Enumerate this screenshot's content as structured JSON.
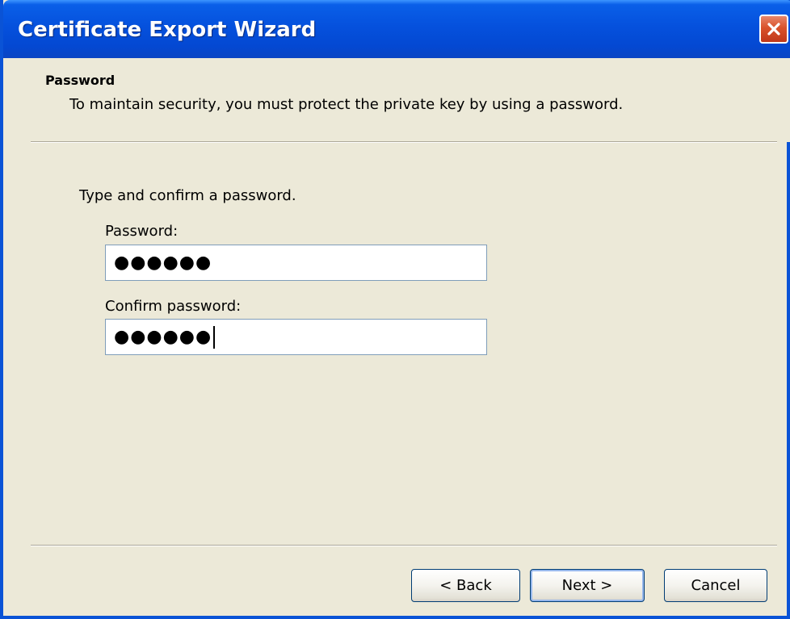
{
  "window": {
    "title": "Certificate Export Wizard",
    "close_icon": "close-icon",
    "accent_color": "#0a53d6",
    "close_color": "#d9532b"
  },
  "header": {
    "title": "Password",
    "description": "To maintain security, you must protect the private key by using a password."
  },
  "body": {
    "instruction": "Type and confirm a password.",
    "password_label": "Password:",
    "password_value": "●●●●●●",
    "confirm_label": "Confirm password:",
    "confirm_value": "●●●●●●"
  },
  "buttons": {
    "back_label": "< Back",
    "next_label": "Next >",
    "cancel_label": "Cancel"
  }
}
